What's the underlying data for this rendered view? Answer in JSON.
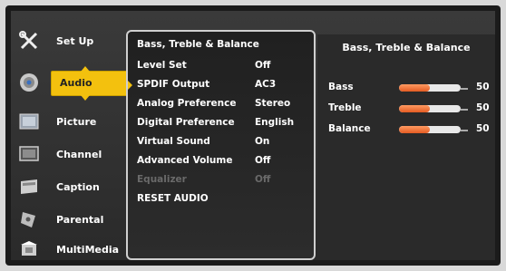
{
  "sidebar": {
    "items": [
      {
        "label": "Set Up",
        "icon": "tools-icon"
      },
      {
        "label": "Audio",
        "icon": "speaker-icon"
      },
      {
        "label": "Picture",
        "icon": "picture-icon"
      },
      {
        "label": "Channel",
        "icon": "tv-icon"
      },
      {
        "label": "Caption",
        "icon": "caption-icon"
      },
      {
        "label": "Parental",
        "icon": "lock-icon"
      },
      {
        "label": "MultiMedia",
        "icon": "multimedia-icon"
      }
    ],
    "active": "Audio"
  },
  "menu": {
    "title": "Bass, Treble & Balance",
    "rows": [
      {
        "label": "Level Set",
        "value": "Off"
      },
      {
        "label": "SPDIF Output",
        "value": "AC3"
      },
      {
        "label": "Analog Preference",
        "value": "Stereo"
      },
      {
        "label": "Digital Preference",
        "value": "English"
      },
      {
        "label": "Virtual Sound",
        "value": "On"
      },
      {
        "label": "Advanced Volume",
        "value": "Off"
      },
      {
        "label": "Equalizer",
        "value": "Off"
      },
      {
        "label": "RESET AUDIO",
        "value": ""
      }
    ]
  },
  "detail": {
    "title": "Bass, Treble & Balance",
    "sliders": [
      {
        "label": "Bass",
        "value": 50
      },
      {
        "label": "Treble",
        "value": 50
      },
      {
        "label": "Balance",
        "value": 50
      }
    ]
  },
  "colors": {
    "accent": "#f3c10e",
    "slider_fill": "#e45b22"
  }
}
